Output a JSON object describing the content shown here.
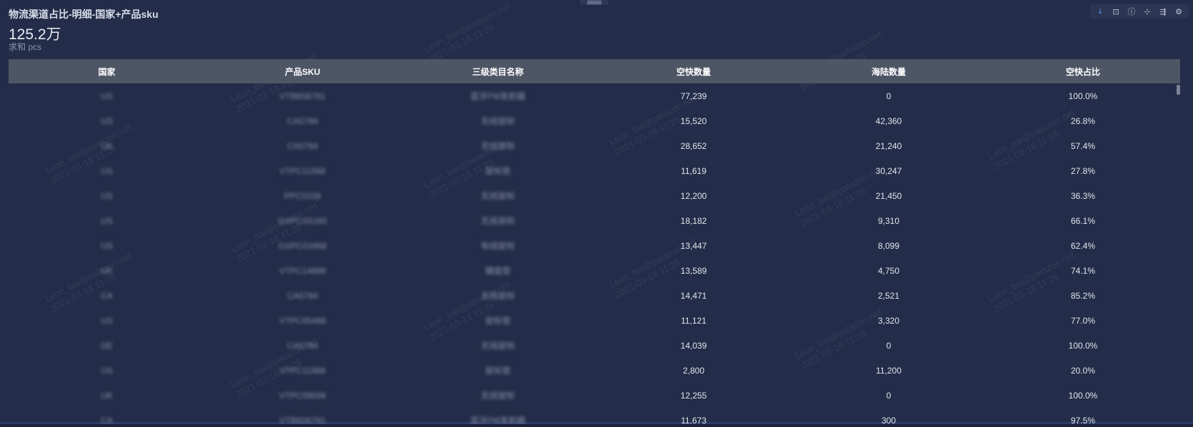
{
  "title": "物流渠道占比-明细-国家+产品sku",
  "kpi": {
    "value": "125.2万",
    "label": "求和 pcs"
  },
  "toolbar": [
    {
      "icon": "download-icon",
      "glyph": "⤓"
    },
    {
      "icon": "export-icon",
      "glyph": "⊡"
    },
    {
      "icon": "info-icon",
      "glyph": "ⓘ"
    },
    {
      "icon": "pivot-icon",
      "glyph": "⊹"
    },
    {
      "icon": "drill-icon",
      "glyph": "⇶"
    },
    {
      "icon": "settings-icon",
      "glyph": "⚙"
    }
  ],
  "table": {
    "columns": [
      "国家",
      "产品SKU",
      "三级类目名称",
      "空快数量",
      "海陆数量",
      "空快占比"
    ],
    "rows": [
      [
        "US",
        "VTB6S6781",
        "蓝牙FM发射器",
        "77,239",
        "0",
        "100.0%"
      ],
      [
        "US",
        "CA5784",
        "无线鼠标",
        "15,520",
        "42,360",
        "26.8%"
      ],
      [
        "UK",
        "CA5784",
        "无线鼠标",
        "28,652",
        "21,240",
        "57.4%"
      ],
      [
        "US",
        "VTPC11568",
        "鼠标垫",
        "11,619",
        "30,247",
        "27.8%"
      ],
      [
        "US",
        "PPC0158",
        "无线鼠标",
        "12,200",
        "21,450",
        "36.3%"
      ],
      [
        "US",
        "GXPC0S160",
        "无线鼠标",
        "18,182",
        "9,310",
        "66.1%"
      ],
      [
        "US",
        "GXPC03468",
        "有线鼠标",
        "13,447",
        "8,099",
        "62.4%"
      ],
      [
        "UK",
        "VTPC14888",
        "键盘垫",
        "13,589",
        "4,750",
        "74.1%"
      ],
      [
        "CA",
        "CA5784",
        "无线鼠标",
        "14,471",
        "2,521",
        "85.2%"
      ],
      [
        "US",
        "VTPC05468",
        "鼠标垫",
        "11,121",
        "3,320",
        "77.0%"
      ],
      [
        "DE",
        "CA5784",
        "无线鼠标",
        "14,039",
        "0",
        "100.0%"
      ],
      [
        "US",
        "VTPC11988",
        "鼠标垫",
        "2,800",
        "11,200",
        "20.0%"
      ],
      [
        "UK",
        "VTPC09568",
        "无线鼠标",
        "12,255",
        "0",
        "100.0%"
      ],
      [
        "CA",
        "VTB6S6781",
        "蓝牙FM发射器",
        "11,673",
        "300",
        "97.5%"
      ]
    ]
  },
  "watermark": {
    "line1": "Leon_bai@patazon.net",
    "line2": "2021-03-18 11:26"
  }
}
